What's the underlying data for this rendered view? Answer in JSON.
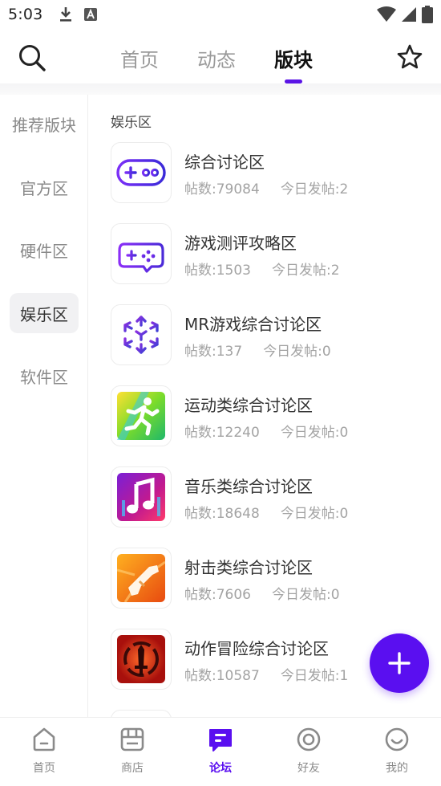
{
  "status_bar": {
    "time": "5:03",
    "icons": [
      "download-icon",
      "font-a-icon",
      "wifi-icon",
      "signal-icon",
      "battery-icon"
    ]
  },
  "top_nav": {
    "tabs": [
      {
        "label": "首页",
        "active": false
      },
      {
        "label": "动态",
        "active": false
      },
      {
        "label": "版块",
        "active": true
      }
    ],
    "accent_color": "#5a14e6"
  },
  "sidebar": {
    "items": [
      {
        "label": "推荐版块",
        "active": false
      },
      {
        "label": "官方区",
        "active": false
      },
      {
        "label": "硬件区",
        "active": false
      },
      {
        "label": "娱乐区",
        "active": true
      },
      {
        "label": "软件区",
        "active": false
      }
    ]
  },
  "main": {
    "section_title": "娱乐区",
    "forums": [
      {
        "name": "综合讨论区",
        "posts": "帖数:79084",
        "today": "今日发帖:2",
        "icon": "gamepad-icon"
      },
      {
        "name": "游戏测评攻略区",
        "posts": "帖数:1503",
        "today": "今日发帖:2",
        "icon": "controller-icon"
      },
      {
        "name": "MR游戏综合讨论区",
        "posts": "帖数:137",
        "today": "今日发帖:0",
        "icon": "mr-arrows-icon"
      },
      {
        "name": "运动类综合讨论区",
        "posts": "帖数:12240",
        "today": "今日发帖:0",
        "icon": "runner-icon"
      },
      {
        "name": "音乐类综合讨论区",
        "posts": "帖数:18648",
        "today": "今日发帖:0",
        "icon": "music-note-icon"
      },
      {
        "name": "射击类综合讨论区",
        "posts": "帖数:7606",
        "today": "今日发帖:0",
        "icon": "gun-icon"
      },
      {
        "name": "动作冒险综合讨论区",
        "posts": "帖数:10587",
        "today": "今日发帖:1",
        "icon": "sword-icon"
      }
    ]
  },
  "fab": {
    "icon": "plus-icon",
    "color": "#5a0ff0"
  },
  "bottom_nav": {
    "items": [
      {
        "label": "首页",
        "icon": "home-icon",
        "active": false
      },
      {
        "label": "商店",
        "icon": "store-icon",
        "active": false
      },
      {
        "label": "论坛",
        "icon": "forum-icon",
        "active": true
      },
      {
        "label": "好友",
        "icon": "friends-icon",
        "active": false
      },
      {
        "label": "我的",
        "icon": "smiley-icon",
        "active": false
      }
    ]
  }
}
